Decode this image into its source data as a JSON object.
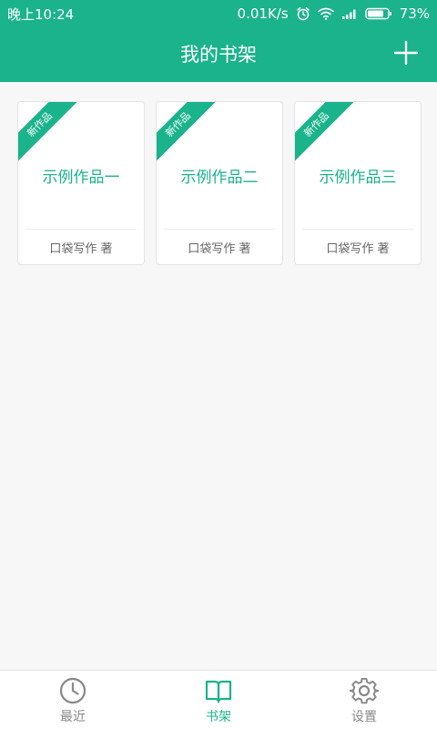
{
  "status_bar": {
    "time": "晚上10:24",
    "speed": "0.01K/s",
    "battery": "73%"
  },
  "header": {
    "title": "我的书架",
    "add_icon": "plus-icon"
  },
  "books": [
    {
      "ribbon": "新作品",
      "title": "示例作品一",
      "author": "口袋写作 著"
    },
    {
      "ribbon": "新作品",
      "title": "示例作品二",
      "author": "口袋写作 著"
    },
    {
      "ribbon": "新作品",
      "title": "示例作品三",
      "author": "口袋写作 著"
    }
  ],
  "bottom_nav": {
    "items": [
      {
        "label": "最近",
        "icon": "clock-icon"
      },
      {
        "label": "书架",
        "icon": "book-icon",
        "active": true
      },
      {
        "label": "设置",
        "icon": "gear-icon"
      }
    ]
  },
  "colors": {
    "brand": "#1ab38c",
    "background": "#f7f7f7",
    "nav_inactive": "#888888"
  }
}
